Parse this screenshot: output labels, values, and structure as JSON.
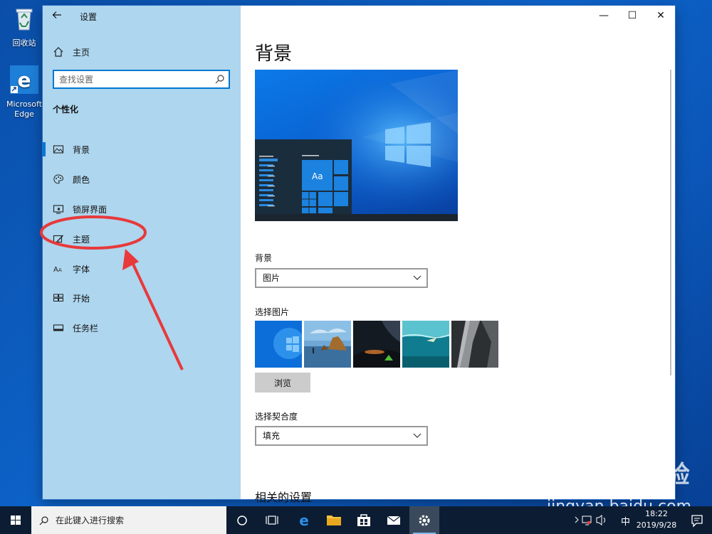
{
  "desktop": {
    "recycle_bin": "回收站",
    "edge_line1": "Microsoft",
    "edge_line2": "Edge"
  },
  "window": {
    "title": "设置",
    "back_icon": "back-arrow-icon",
    "controls": {
      "minimize": "—",
      "maximize": "☐",
      "close": "✕"
    }
  },
  "sidebar": {
    "home_label": "主页",
    "search_placeholder": "查找设置",
    "section_title": "个性化",
    "items": [
      {
        "label": "背景",
        "icon": "picture-icon",
        "active": true
      },
      {
        "label": "颜色",
        "icon": "palette-icon",
        "active": false
      },
      {
        "label": "锁屏界面",
        "icon": "lock-screen-icon",
        "active": false
      },
      {
        "label": "主题",
        "icon": "theme-brush-icon",
        "active": false
      },
      {
        "label": "字体",
        "icon": "font-icon",
        "active": false
      },
      {
        "label": "开始",
        "icon": "start-tiles-icon",
        "active": false
      },
      {
        "label": "任务栏",
        "icon": "taskbar-icon",
        "active": false
      }
    ]
  },
  "main": {
    "title": "背景",
    "preview_tile_label": "Aa",
    "background_label": "背景",
    "background_value": "图片",
    "choose_picture_label": "选择图片",
    "browse_label": "浏览",
    "fit_label": "选择契合度",
    "fit_value": "填充",
    "related_settings": "相关的设置"
  },
  "taskbar": {
    "search_placeholder": "在此键入进行搜索",
    "ime": "中",
    "time": "18:22",
    "date": "2019/9/28"
  },
  "watermark": {
    "logo": "Bai du 经验",
    "url": "jingyan.baidu.com"
  },
  "colors": {
    "accent": "#0078d4",
    "sidebar_bg": "#aed6ee",
    "annotation": "#e8393b",
    "taskbar_bg": "#0c1d33"
  }
}
